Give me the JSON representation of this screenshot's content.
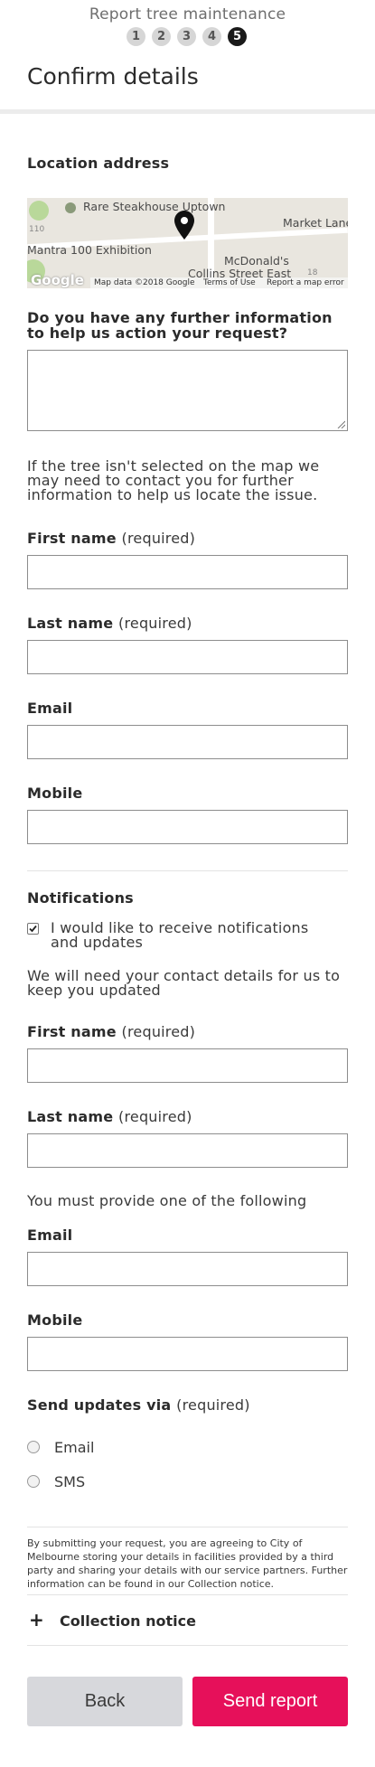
{
  "header": {
    "title": "Report tree maintenance",
    "steps": [
      "1",
      "2",
      "3",
      "4",
      "5"
    ],
    "active_step": "5",
    "page_title": "Confirm details"
  },
  "location": {
    "label": "Location address",
    "map": {
      "place_1": "Rare Steakhouse Uptown",
      "place_2": "Market Lane",
      "place_3": "Mantra 100 Exhibition",
      "place_4": "McDonald's",
      "place_5": "Collins Street East",
      "number_1": "110",
      "number_2": "18",
      "logo": "Google",
      "attribution": "Map data ©2018 Google",
      "terms": "Terms of Use",
      "report_error": "Report a map error"
    }
  },
  "further_info": {
    "label": "Do you have any further information to help us action your request?",
    "value": ""
  },
  "tree_note": "If the tree isn't selected on the map we may need to contact you for further information to help us locate the issue.",
  "contact": {
    "first_name_label": "First name",
    "last_name_label": "Last name",
    "email_label": "Email",
    "mobile_label": "Mobile",
    "required": "(required)",
    "first_name_value": "",
    "last_name_value": "",
    "email_value": "",
    "mobile_value": ""
  },
  "notifications": {
    "heading": "Notifications",
    "checkbox_label": "I would like to receive notifications and updates",
    "checked": true,
    "note": "We will need your contact details for us to keep you updated",
    "first_name_label": "First name",
    "last_name_label": "Last name",
    "required": "(required)",
    "provide_one": "You must provide one of the following",
    "email_label": "Email",
    "mobile_label": "Mobile",
    "send_via_label": "Send updates via",
    "send_via_required": "(required)",
    "options": [
      "Email",
      "SMS"
    ]
  },
  "small_print": "By submitting your request, you are agreeing to City of Melbourne storing your details in facilities provided by a third party and sharing your details with our service partners. Further information can be found in our Collection notice.",
  "collection_notice": {
    "icon": "plus-icon",
    "label": "Collection notice"
  },
  "buttons": {
    "back": "Back",
    "send": "Send report"
  },
  "colors": {
    "accent": "#e6105a",
    "secondary_button": "#d7d8dc"
  }
}
